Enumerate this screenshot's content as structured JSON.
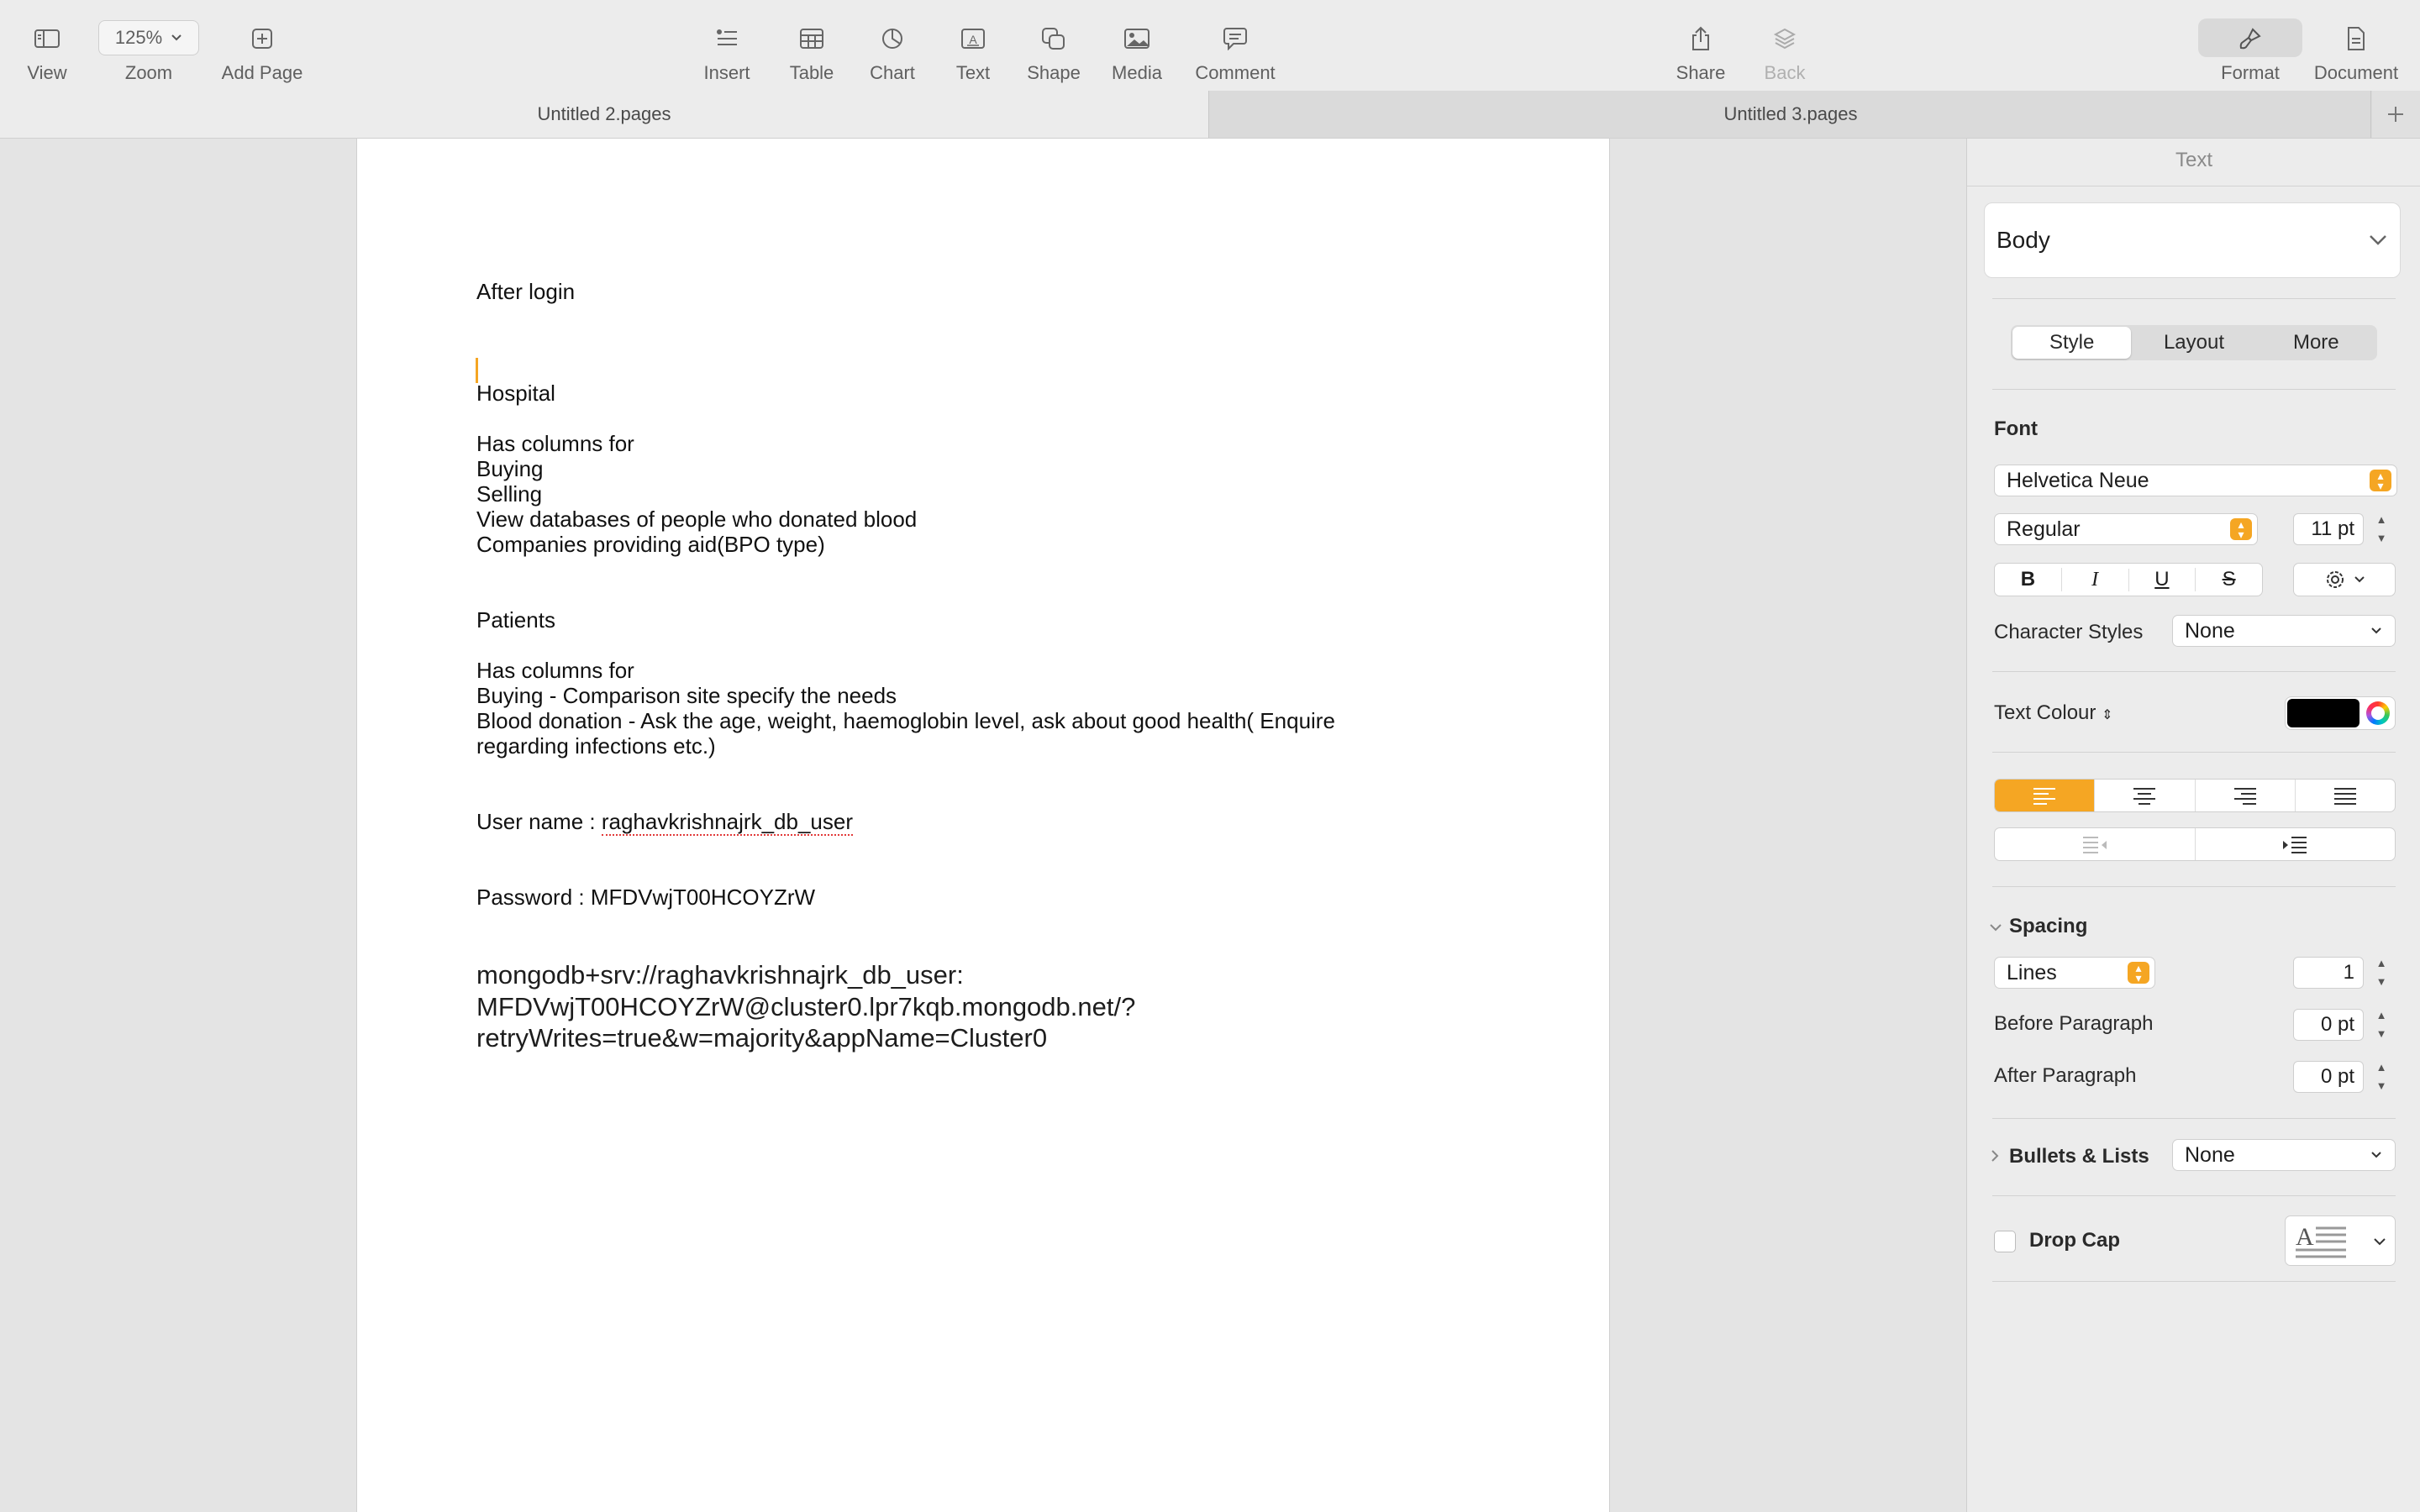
{
  "toolbar": {
    "view": "View",
    "zoom_label": "Zoom",
    "zoom_value": "125%",
    "add_page": "Add Page",
    "insert": "Insert",
    "table": "Table",
    "chart": "Chart",
    "text": "Text",
    "shape": "Shape",
    "media": "Media",
    "comment": "Comment",
    "share": "Share",
    "back": "Back",
    "format": "Format",
    "document": "Document"
  },
  "tabs": [
    {
      "label": "Untitled 2.pages",
      "active": true
    },
    {
      "label": "Untitled 3.pages",
      "active": false
    }
  ],
  "document": {
    "lines": [
      "After login",
      "Hospital",
      "Has columns for",
      "Buying",
      "Selling",
      "View databases of people who donated blood",
      "Companies providing aid(BPO type)",
      "Patients",
      "Has columns for",
      "Buying - Comparison site specify the needs",
      "Blood donation - Ask the age, weight, haemoglobin level, ask about good health( Enquire",
      "regarding infections etc.)",
      "User name : ",
      "raghavkrishnajrk_db_user",
      "Password : MFDVwjT00HCOYZrW",
      "mongodb+srv://raghavkrishnajrk_db_user:",
      "MFDVwjT00HCOYZrW@cluster0.lpr7kqb.mongodb.net/?",
      "retryWrites=true&w=majority&appName=Cluster0"
    ]
  },
  "inspector": {
    "title": "Text",
    "paragraph_style": "Body",
    "tabs": [
      "Style",
      "Layout",
      "More"
    ],
    "font_section": "Font",
    "font_family": "Helvetica Neue",
    "font_weight": "Regular",
    "font_size": "11 pt",
    "bold": "B",
    "italic": "I",
    "underline": "U",
    "strike": "S",
    "character_styles_label": "Character Styles",
    "character_styles_value": "None",
    "text_colour_label": "Text Colour",
    "text_colour": "#000000",
    "accent": "#f5a623",
    "spacing_label": "Spacing",
    "spacing_mode": "Lines",
    "spacing_value": "1",
    "before_paragraph_label": "Before Paragraph",
    "before_paragraph_value": "0 pt",
    "after_paragraph_label": "After Paragraph",
    "after_paragraph_value": "0 pt",
    "bullets_label": "Bullets & Lists",
    "bullets_value": "None",
    "drop_cap_label": "Drop Cap"
  }
}
